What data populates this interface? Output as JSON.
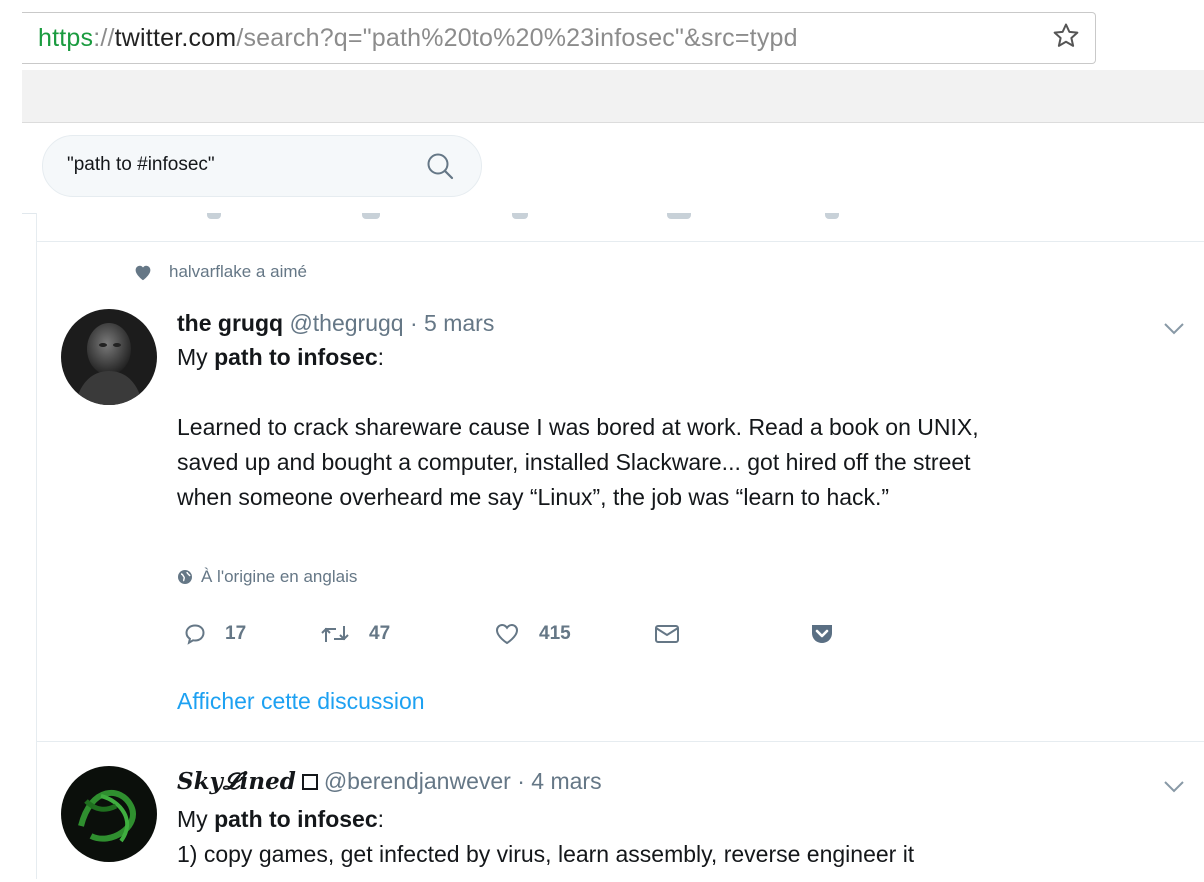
{
  "browser": {
    "url_scheme": "https",
    "url_sep": "://",
    "url_host": "twitter.com",
    "url_path": "/search?q=\"path%20to%20%23infosec\"&src=typd",
    "bookmark_icon": "star-icon"
  },
  "search": {
    "value": "\"path to #infosec\"",
    "icon": "search-icon"
  },
  "tweets": [
    {
      "context": "halvarflake a aimé",
      "fullname": "the grugq",
      "screenname": "@thegrugq",
      "dot": " · ",
      "time": "5 mars",
      "intro_pre": "My ",
      "intro_bold": "path to infosec",
      "intro_post": ":",
      "paragraph_lines": [
        "Learned to crack shareware cause I was bored at work. Read a book on UNIX,",
        "saved up and bought a computer, installed Slackware... got hired off the street",
        "when someone overheard me say “Linux”, the job was “learn to hack.”"
      ],
      "translation": "À l'origine en anglais",
      "reply_count": "17",
      "retweet_count": "47",
      "like_count": "415",
      "show_thread": "Afficher cette discussion"
    },
    {
      "fullname": "𝑺𝒌𝒚𝓛𝒊𝒏𝒆𝒅",
      "screenname": "@berendjanwever",
      "dot": " · ",
      "time": "4 mars",
      "intro_pre": "My ",
      "intro_bold": "path to infosec",
      "intro_post": ":",
      "line1": "1) copy games, get infected by virus, learn assembly, reverse engineer it"
    }
  ],
  "colors": {
    "link": "#1da1f2",
    "muted": "#657786",
    "url_secure": "#1a9b3f"
  }
}
